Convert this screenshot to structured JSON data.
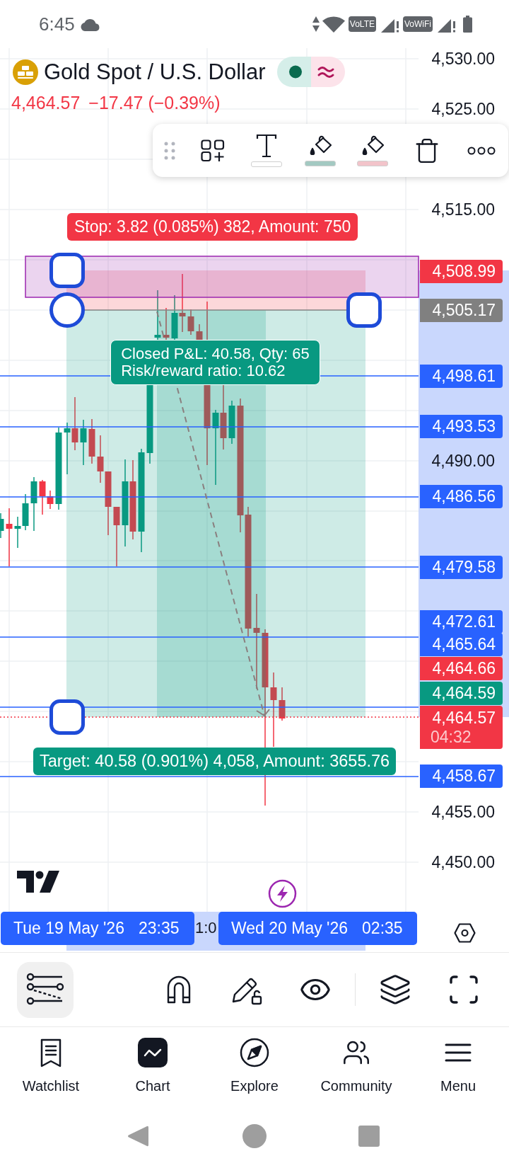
{
  "status_bar": {
    "time": "6:45",
    "indicators": [
      "VoLTE",
      "VoWiFi"
    ]
  },
  "symbol": {
    "title": "Gold Spot / U.S. Dollar",
    "price": "4,464.57",
    "change": "−17.47 (−0.39%)"
  },
  "drawing_toolbar": {
    "color_swatches": [
      {
        "color": "#ffffff"
      },
      {
        "color": "#a3c9c2"
      },
      {
        "color": "#f2c4ca"
      }
    ]
  },
  "position": {
    "stop_label": "Stop: 3.82 (0.085%) 382, Amount: 750",
    "result_label": [
      "Closed P&L: 40.58, Qty: 65",
      "Risk/reward ratio: 10.62"
    ],
    "target_label": "Target: 40.58 (0.901%) 4,058, Amount: 3655.76"
  },
  "price_axis": {
    "ticks": [
      "4,530.00",
      "4,525.00",
      "4,515.00",
      "4,490.00",
      "4,455.00",
      "4,450.00"
    ],
    "markers": [
      {
        "value": "4,508.99",
        "color": "#f23645"
      },
      {
        "value": "4,505.17",
        "color": "#808080"
      },
      {
        "value": "4,498.61",
        "color": "#2962ff"
      },
      {
        "value": "4,493.53",
        "color": "#2962ff"
      },
      {
        "value": "4,486.56",
        "color": "#2962ff"
      },
      {
        "value": "4,479.58",
        "color": "#2962ff"
      },
      {
        "value": "4,472.61",
        "color": "#2962ff"
      },
      {
        "value": "4,465.64",
        "color": "#2962ff"
      },
      {
        "value": "4,464.66",
        "color": "#f23645"
      },
      {
        "value": "4,464.59",
        "color": "#089981"
      },
      {
        "value": "4,464.57",
        "color": "#f23645",
        "countdown": "04:32"
      },
      {
        "value": "4,458.67",
        "color": "#2962ff"
      }
    ]
  },
  "time_axis": {
    "range_labels": [
      {
        "date": "Tue 19 May '26",
        "time": "23:35"
      },
      {
        "date": "Wed 20 May '26",
        "time": "02:35"
      }
    ],
    "tick": "1:0"
  },
  "chart_toolbar": {
    "drawings_active": true
  },
  "tab_bar": [
    {
      "label": "Watchlist",
      "selected": false
    },
    {
      "label": "Chart",
      "selected": true
    },
    {
      "label": "Explore",
      "selected": false
    },
    {
      "label": "Community",
      "selected": false
    },
    {
      "label": "Menu",
      "selected": false
    }
  ]
}
